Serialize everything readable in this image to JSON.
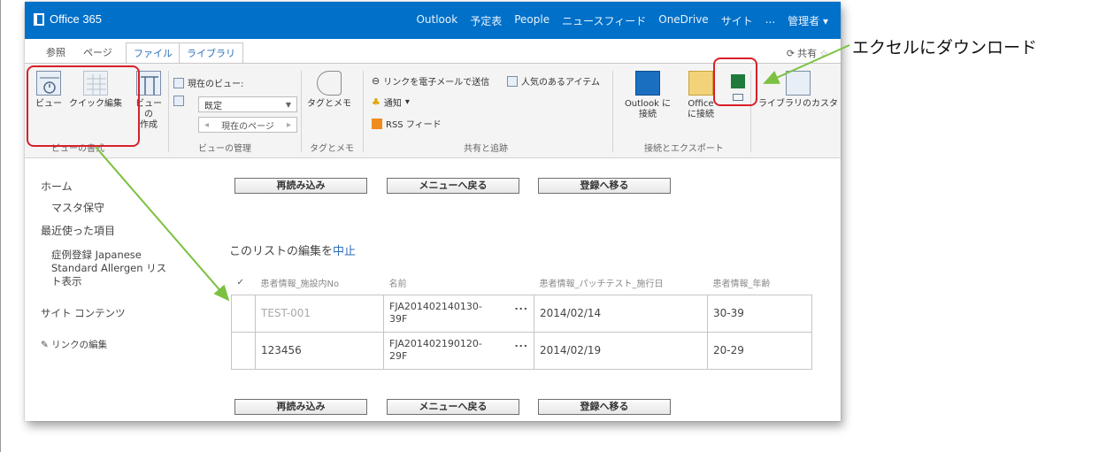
{
  "suitebar": {
    "brand": "Office 365",
    "nav": [
      "Outlook",
      "予定表",
      "People",
      "ニュースフィード",
      "OneDrive",
      "サイト",
      "...",
      "管理者 ▾"
    ]
  },
  "tabs": [
    "参照",
    "ページ",
    "ファイル",
    "ライブラリ"
  ],
  "share": "共有",
  "ribbon": {
    "view_btn": "ビュー",
    "quick_edit": "クイック編集",
    "create_view": [
      "ビューの",
      "作成"
    ],
    "current_view_label": "現在のビュー:",
    "current_view_value": "既定",
    "current_page": "現在のページ",
    "tags_notes": "タグとメモ",
    "email_link": "リンクを電子メールで送信",
    "popular": "人気のあるアイテム",
    "alert": "通知",
    "rss": "RSS フィード",
    "outlook_connect": [
      "Outlook に",
      "接続"
    ],
    "office_connect": [
      "Office",
      "に接続"
    ],
    "library_settings": "ライブラリのカスタ",
    "groups": [
      "ビューの書式",
      "ビューの管理",
      "タグとメモ",
      "共有と追跡",
      "接続とエクスポート"
    ]
  },
  "leftnav": [
    "ホーム",
    "マスタ保守",
    "最近使った項目",
    "症例登録 Japanese",
    "Standard Allergen リス",
    "ト表示",
    "サイト コンテンツ",
    "リンクの編集"
  ],
  "buttons": {
    "reload": "再読み込み",
    "back": "メニューへ戻る",
    "register": "登録へ移る"
  },
  "stopedit": {
    "prefix": "このリストの編集を",
    "link": "中止"
  },
  "grid": {
    "headers": [
      "✓",
      "患者情報_施設内No",
      "名前",
      "患者情報_パッチテスト_施行日",
      "患者情報_年齢"
    ],
    "rows": [
      {
        "no": "TEST-001",
        "name1": "FJA201402140130-",
        "name2": "39F",
        "date": "2014/02/14",
        "age": "30-39"
      },
      {
        "no": "123456",
        "name1": "FJA201402190120-",
        "name2": "29F",
        "date": "2014/02/19",
        "age": "20-29"
      }
    ],
    "ellipsis": "..."
  },
  "annotation": "エクセルにダウンロード",
  "colors": {
    "suitebar": "#0070c9",
    "annotation_box": "#d8202a",
    "arrow": "#7bc142"
  }
}
